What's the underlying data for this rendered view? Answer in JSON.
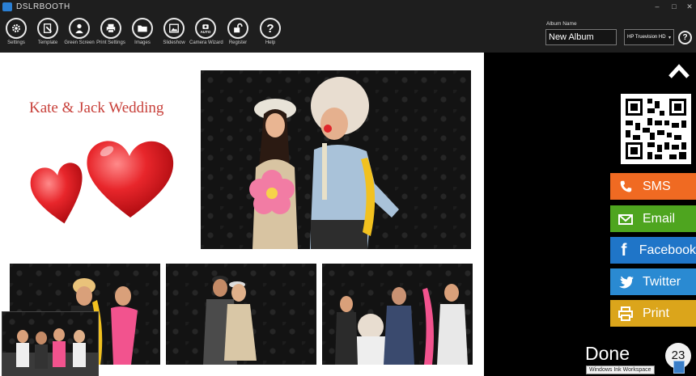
{
  "app": {
    "title": "DSLRBOOTH"
  },
  "window_controls": [
    "–",
    "□",
    "✕"
  ],
  "toolbar": {
    "items": [
      {
        "label": "Settings",
        "icon": "gear-icon"
      },
      {
        "label": "Template",
        "icon": "template-icon"
      },
      {
        "label": "Green Screen",
        "icon": "person-icon"
      },
      {
        "label": "Print Settings",
        "icon": "printer-icon"
      },
      {
        "label": "Images",
        "icon": "folder-icon"
      },
      {
        "label": "Slideshow",
        "icon": "picture-icon"
      },
      {
        "label": "Camera Wizard",
        "icon": "camera-auto-icon"
      },
      {
        "label": "Register",
        "icon": "unlock-icon"
      },
      {
        "label": "Help",
        "icon": "question-icon"
      }
    ],
    "camera_badge": "AUTO"
  },
  "album": {
    "label": "Album Name",
    "value": "New Album"
  },
  "printer": {
    "selected": "HP Truevision HD",
    "caret": "▾"
  },
  "help_glyph": "?",
  "template": {
    "event_title": "Kate & Jack Wedding",
    "heart_color": "#e8262b"
  },
  "share": {
    "buttons": [
      {
        "label": "SMS",
        "color": "#f06a22",
        "icon": "phone-icon"
      },
      {
        "label": "Email",
        "color": "#4ea51f",
        "icon": "envelope-icon"
      },
      {
        "label": "Facebook",
        "color": "#1f75c8",
        "icon": "facebook-icon"
      },
      {
        "label": "Twitter",
        "color": "#2a8ad2",
        "icon": "twitter-icon"
      },
      {
        "label": "Print",
        "color": "#dba51b",
        "icon": "printer-icon"
      }
    ]
  },
  "done_label": "Done",
  "countdown": "23",
  "tooltip": "Windows Ink Workspace"
}
